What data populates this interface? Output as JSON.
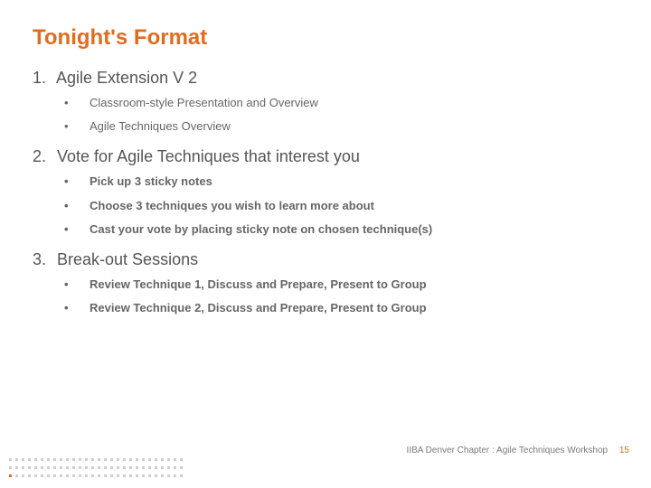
{
  "title": "Tonight's Format",
  "sections": [
    {
      "number": "1.",
      "heading": "Agile Extension V 2",
      "bullets": [
        "Classroom-style Presentation and Overview",
        "Agile Techniques Overview"
      ]
    },
    {
      "number": "2.",
      "heading": "Vote for Agile Techniques that interest you",
      "bullets": [
        "Pick up 3 sticky notes",
        "Choose 3 techniques you wish to learn more about",
        "Cast your vote by placing sticky note on chosen technique(s)"
      ]
    },
    {
      "number": "3.",
      "heading": "Break-out Sessions",
      "bullets": [
        "Review Technique 1, Discuss and Prepare, Present to Group",
        "Review Technique 2, Discuss and Prepare, Present to Group"
      ]
    }
  ],
  "footer": {
    "text": "IIBA Denver Chapter : Agile Techniques Workshop",
    "page": "15"
  }
}
